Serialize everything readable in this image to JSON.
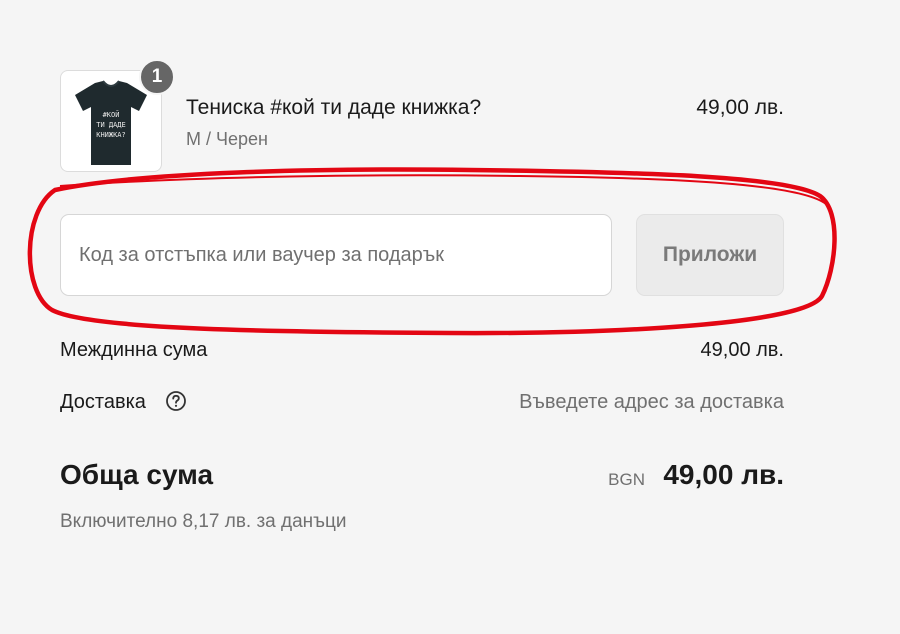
{
  "product": {
    "quantity": "1",
    "title": "Тениска #кой ти даде книжка?",
    "variant": "M / Черен",
    "price": "49,00 лв.",
    "image_icon": "tshirt-icon",
    "shirt_color": "#1f2a2e",
    "print_color": "#e8e8e8"
  },
  "discount": {
    "placeholder": "Код за отстъпка или ваучер за подарък",
    "value": "",
    "apply_label": "Приложи"
  },
  "summary": {
    "subtotal_label": "Междинна сума",
    "subtotal_value": "49,00 лв.",
    "shipping_label": "Доставка",
    "shipping_help_icon": "question-circle-icon",
    "shipping_value": "Въведете адрес за доставка",
    "total_label": "Обща сума",
    "total_currency": "BGN",
    "total_value": "49,00 лв.",
    "tax_note": "Включително 8,17 лв. за данъци"
  },
  "colors": {
    "background": "#f5f5f5",
    "annotation_red": "#e30613",
    "muted_text": "#707070",
    "badge": "#666666"
  }
}
